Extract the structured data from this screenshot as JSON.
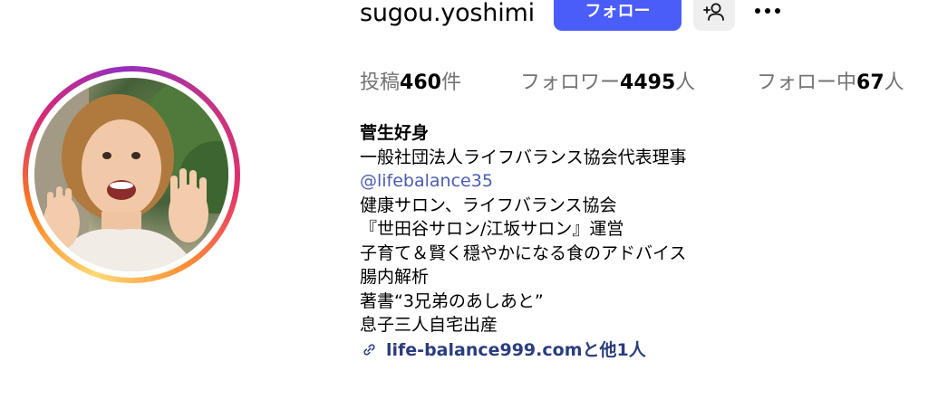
{
  "profile": {
    "username": "sugou.yoshimi",
    "follow_label": "フォロー",
    "stats": [
      {
        "label": "投稿",
        "count": "460",
        "unit": "件"
      },
      {
        "label": "フォロワー",
        "count": "4495",
        "unit": "人"
      },
      {
        "label": "フォロー中",
        "count": "67",
        "unit": "人"
      }
    ],
    "bio": {
      "name": "菅生好身",
      "line1": "一般社団法人ライフバランス協会代表理事",
      "mention": "@lifebalance35",
      "line3": "健康サロン、ライフバランス協会",
      "line4": "『世田谷サロン/江坂サロン』運営",
      "line5": "子育て＆賢く穏やかになる食のアドバイス",
      "line6": "腸内解析",
      "line7": "著書“3兄弟のあしあと”",
      "line8": "息子三人自宅出産",
      "link": "life-balance999.comと他1人"
    }
  },
  "icons": {
    "add_user": "person-add-icon",
    "more": "more-horizontal-icon",
    "link": "link-icon"
  },
  "colors": {
    "follow_button": "#4a5df9",
    "secondary_button": "#efefef",
    "mention": "#4a5db0",
    "link": "#2b3d7d",
    "muted_text": "#737373"
  }
}
